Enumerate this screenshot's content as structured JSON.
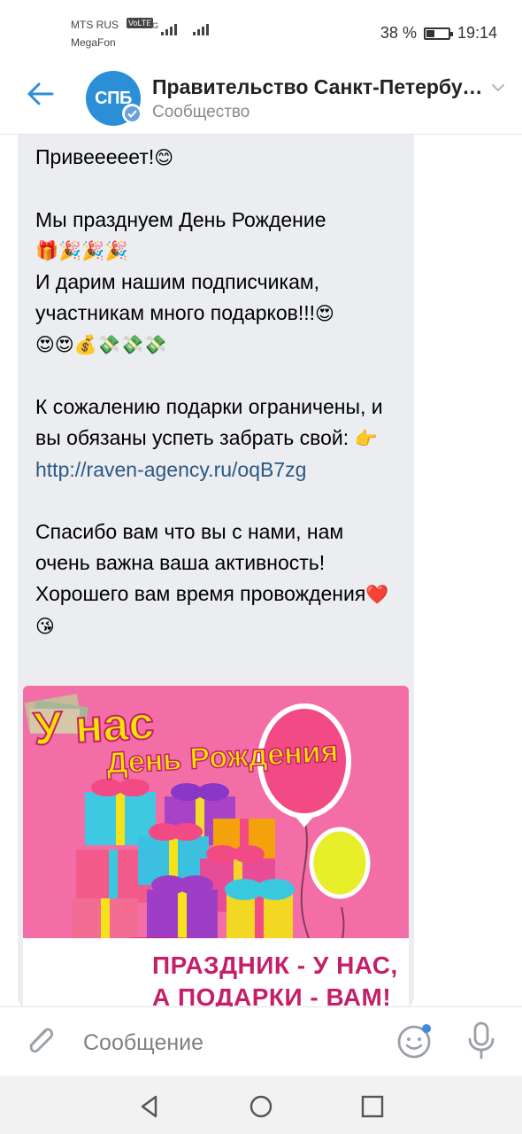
{
  "status_bar": {
    "carrier_1": "MTS RUS",
    "carrier_2": "MegaFon",
    "volte_label": "VoLTE",
    "network_label": "4G",
    "battery_percent": "38 %",
    "battery_level": 0.38,
    "time": "19:14"
  },
  "header": {
    "back_icon": "arrow-left-icon",
    "avatar_text": "СПБ",
    "title": "Правительство Санкт-Петербурга",
    "subtitle": "Сообщество",
    "chevron_icon": "chevron-down-icon"
  },
  "message": {
    "greeting": "Привееееет!",
    "line_1": "Мы празднуем День Рождение",
    "line_2": "И дарим нашим подписчикам, участникам много подарков!!!",
    "line_3": "К сожалению подарки ограничены, и вы обязаны успеть забрать свой:",
    "link": "http://raven-agency.ru/oqB7zg",
    "line_4": "Спасибо вам что вы с нами, нам очень важна ваша активность! Хорошего вам время провождения",
    "emoji": {
      "smile": "😊",
      "row_1": "🎁🎉🎉🎉",
      "love_inline": "😍",
      "row_2": "😍😍💰💸💸💸",
      "point": "👉",
      "heart_kiss": "❤️😘"
    }
  },
  "promo_image": {
    "headline_1": "У нас",
    "headline_2": "День Рождения",
    "banner_line_1": "ПРАЗДНИК - У НАС,",
    "banner_line_2": "А ПОДАРКИ - ВАМ!",
    "colors": {
      "background": "#f36ea7",
      "headline": "#f3e300",
      "banner_text": "#c51f6b"
    }
  },
  "composer": {
    "placeholder": "Сообщение",
    "attach_icon": "paperclip-icon",
    "emoji_icon": "smile-icon",
    "mic_icon": "microphone-icon"
  },
  "nav_bar": {
    "back_icon": "nav-back-triangle-icon",
    "home_icon": "nav-home-circle-icon",
    "recents_icon": "nav-recents-square-icon"
  },
  "colors": {
    "accent": "#2a8fd6",
    "link": "#2a5885",
    "bubble": "#ebedf0"
  }
}
